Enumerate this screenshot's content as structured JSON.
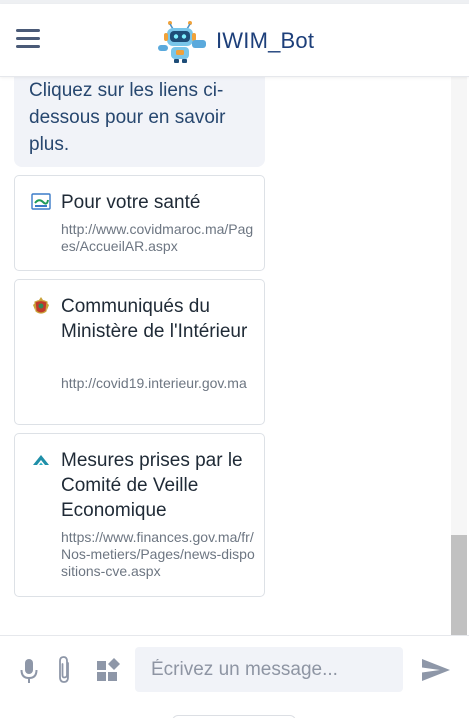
{
  "header": {
    "title": "IWIM_Bot",
    "menu_icon": "hamburger-menu-icon",
    "logo_icon": "robot-logo-icon"
  },
  "message": {
    "text": "Cliquez sur les liens ci-dessous pour en savoir plus."
  },
  "links": [
    {
      "title": "Pour votre santé",
      "url": "http://www.covidmaroc.ma/Pages/AccueilAR.aspx",
      "icon": "covid-maroc-favicon"
    },
    {
      "title": "Communiqués du Ministère de l'Intérieur",
      "url": "http://covid19.interieur.gov.ma",
      "icon": "ministry-emblem-favicon"
    },
    {
      "title": "Mesures prises par le Comité de Veille Economique",
      "url": "https://www.finances.gov.ma/fr/Nos-metiers/Pages/news-dispositions-cve.aspx",
      "icon": "finance-ministry-favicon"
    }
  ],
  "composer": {
    "placeholder": "Écrivez un message...",
    "icons": [
      "microphone-icon",
      "attachment-icon",
      "widgets-icon",
      "send-icon"
    ]
  },
  "colors": {
    "brand": "#1d3f7a",
    "bubble": "#f1f3f8",
    "icon": "#8e97a8"
  }
}
